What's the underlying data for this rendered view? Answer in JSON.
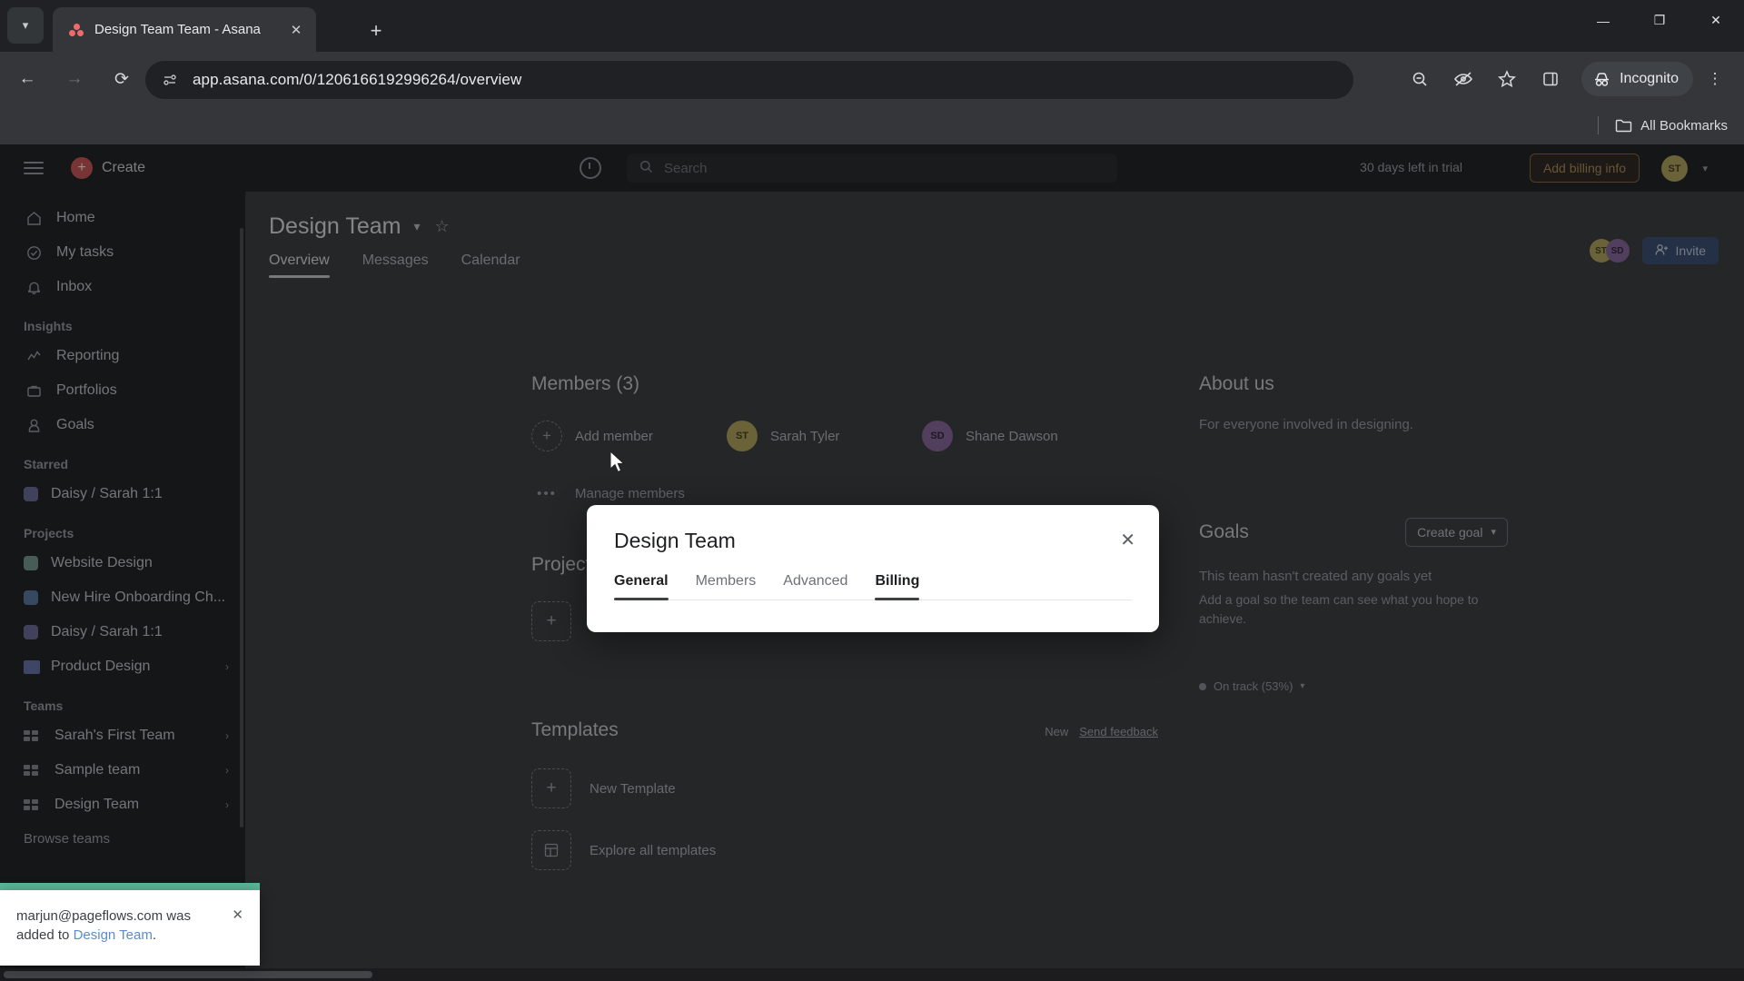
{
  "browser": {
    "tab": {
      "title": "Design Team Team - Asana",
      "favicon": "asana-logo-icon",
      "close": "✕"
    },
    "tab_list_btn": "▾",
    "new_tab": "+",
    "window_controls": {
      "minimize": "—",
      "maximize": "❐",
      "close": "✕"
    },
    "nav": {
      "back": "←",
      "forward": "→",
      "reload": "⟳"
    },
    "omnibox": {
      "url": "app.asana.com/0/1206166192996264/overview",
      "site_icon": "site-settings-icon"
    },
    "toolbar_icons": {
      "zoom": "search-minus-icon",
      "tracking": "eye-slash-icon",
      "bookmark": "star-icon",
      "side_panel": "side-panel-icon",
      "menu": "⋮"
    },
    "profile": {
      "label": "Incognito",
      "icon": "incognito-hat-icon"
    },
    "bookmarks": {
      "label": "All Bookmarks",
      "icon": "folder-icon"
    }
  },
  "asana": {
    "topbar": {
      "menu_icon": "hamburger-icon",
      "create_label": "Create",
      "create_icon": "plus-icon",
      "history_icon": "clock-icon",
      "search_placeholder": "Search",
      "search_icon": "search-icon",
      "trial_text": "30 days left in trial",
      "billing_label": "Add billing info",
      "avatar_initials": "ST",
      "avatar_caret": "▾"
    },
    "sidebar": {
      "primary": [
        {
          "label": "Home",
          "icon": "home-icon"
        },
        {
          "label": "My tasks",
          "icon": "check-circle-icon"
        },
        {
          "label": "Inbox",
          "icon": "bell-icon"
        }
      ],
      "insights_label": "Insights",
      "insights": [
        {
          "label": "Reporting",
          "icon": "chart-line-icon"
        },
        {
          "label": "Portfolios",
          "icon": "briefcase-icon"
        },
        {
          "label": "Goals",
          "icon": "goal-icon"
        }
      ],
      "starred_label": "Starred",
      "starred": [
        {
          "label": "Daisy / Sarah 1:1",
          "color": "#6d6e9f"
        }
      ],
      "projects_label": "Projects",
      "projects": [
        {
          "label": "Website Design",
          "color": "#7a9e95"
        },
        {
          "label": "New Hire Onboarding Ch...",
          "color": "#5c7aa8"
        },
        {
          "label": "Daisy / Sarah 1:1",
          "color": "#6d6e9f"
        },
        {
          "label": "Product Design",
          "color": "#6a77b0",
          "chevron": "›",
          "is_folder": true
        }
      ],
      "teams_label": "Teams",
      "teams": [
        {
          "label": "Sarah's First Team",
          "chevron": "›"
        },
        {
          "label": "Sample team",
          "chevron": "›"
        },
        {
          "label": "Design Team",
          "chevron": "›"
        }
      ],
      "browse_teams": "Browse teams"
    },
    "page": {
      "title": "Design Team",
      "title_caret": "▾",
      "star_icon": "star-outline-icon",
      "tabs": [
        {
          "label": "Overview",
          "active": true
        },
        {
          "label": "Messages",
          "active": false
        },
        {
          "label": "Calendar",
          "active": false
        }
      ],
      "head_avatars": [
        {
          "initials": "ST",
          "color": "#b9a95e"
        },
        {
          "initials": "SD",
          "color": "#8a6aa0"
        }
      ],
      "invite_label": "Invite",
      "invite_icon": "person-add-icon"
    },
    "members": {
      "title": "Members (3)",
      "add_label": "Add member",
      "add_icon": "plus-icon",
      "list": [
        {
          "name": "Sarah Tyler",
          "initials": "ST",
          "color": "#b9a95e"
        },
        {
          "name": "Shane Dawson",
          "initials": "SD",
          "color": "#8a6aa0"
        }
      ],
      "manage_label": "Manage members",
      "manage_icon": "ellipsis-icon"
    },
    "projects_section": {
      "title": "Projects",
      "new_project_icon": "plus-icon"
    },
    "templates_section": {
      "title": "Templates",
      "badge": "New",
      "feedback_link": "Send feedback",
      "items": [
        {
          "label": "New Template",
          "icon": "plus-icon"
        },
        {
          "label": "Explore all templates",
          "icon": "grid-icon"
        }
      ]
    },
    "about": {
      "title": "About us",
      "body": "For everyone involved in designing."
    },
    "goals": {
      "title": "Goals",
      "create_label": "Create goal",
      "create_caret": "▾",
      "empty_title": "This team hasn't created any goals yet",
      "empty_body": "Add a goal so the team can see what you hope to achieve.",
      "status_label": "On track (53%)",
      "status_caret": "▾",
      "status_color": "#8d9197"
    },
    "modal": {
      "title": "Design Team",
      "close_icon": "✕",
      "tabs": [
        {
          "label": "General",
          "selected": true
        },
        {
          "label": "Members",
          "selected": false
        },
        {
          "label": "Advanced",
          "selected": false
        },
        {
          "label": "Billing",
          "selected": true
        }
      ]
    },
    "toast": {
      "text_before": "marjun@pageflows.com was added to ",
      "link": "Design Team",
      "text_after": ".",
      "close_icon": "✕",
      "accent_color": "#5cb89a"
    }
  }
}
